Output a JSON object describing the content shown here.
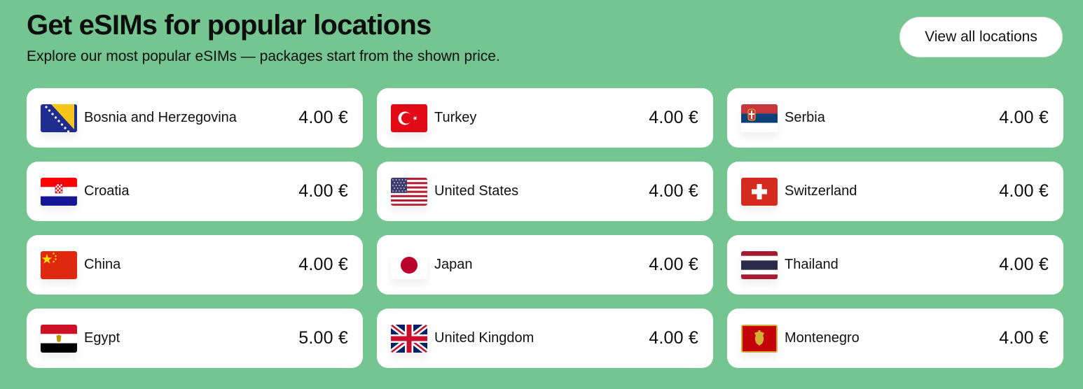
{
  "header": {
    "title": "Get eSIMs for popular locations",
    "subtitle": "Explore our most popular eSIMs — packages start from the shown price."
  },
  "view_all_label": "View all locations",
  "locations": [
    {
      "name": "Bosnia and Herzegovina",
      "price": "4.00 €",
      "flag": "flag-bosnia-and-herzegovina"
    },
    {
      "name": "Turkey",
      "price": "4.00 €",
      "flag": "flag-turkey"
    },
    {
      "name": "Serbia",
      "price": "4.00 €",
      "flag": "flag-serbia"
    },
    {
      "name": "Croatia",
      "price": "4.00 €",
      "flag": "flag-croatia"
    },
    {
      "name": "United States",
      "price": "4.00 €",
      "flag": "flag-united-states"
    },
    {
      "name": "Switzerland",
      "price": "4.00 €",
      "flag": "flag-switzerland"
    },
    {
      "name": "China",
      "price": "4.00 €",
      "flag": "flag-china"
    },
    {
      "name": "Japan",
      "price": "4.00 €",
      "flag": "flag-japan"
    },
    {
      "name": "Thailand",
      "price": "4.00 €",
      "flag": "flag-thailand"
    },
    {
      "name": "Egypt",
      "price": "5.00 €",
      "flag": "flag-egypt"
    },
    {
      "name": "United Kingdom",
      "price": "4.00 €",
      "flag": "flag-united-kingdom"
    },
    {
      "name": "Montenegro",
      "price": "4.00 €",
      "flag": "flag-montenegro"
    }
  ],
  "colors": {
    "background": "#74c590",
    "card": "#ffffff",
    "text": "#0e0e0e"
  }
}
